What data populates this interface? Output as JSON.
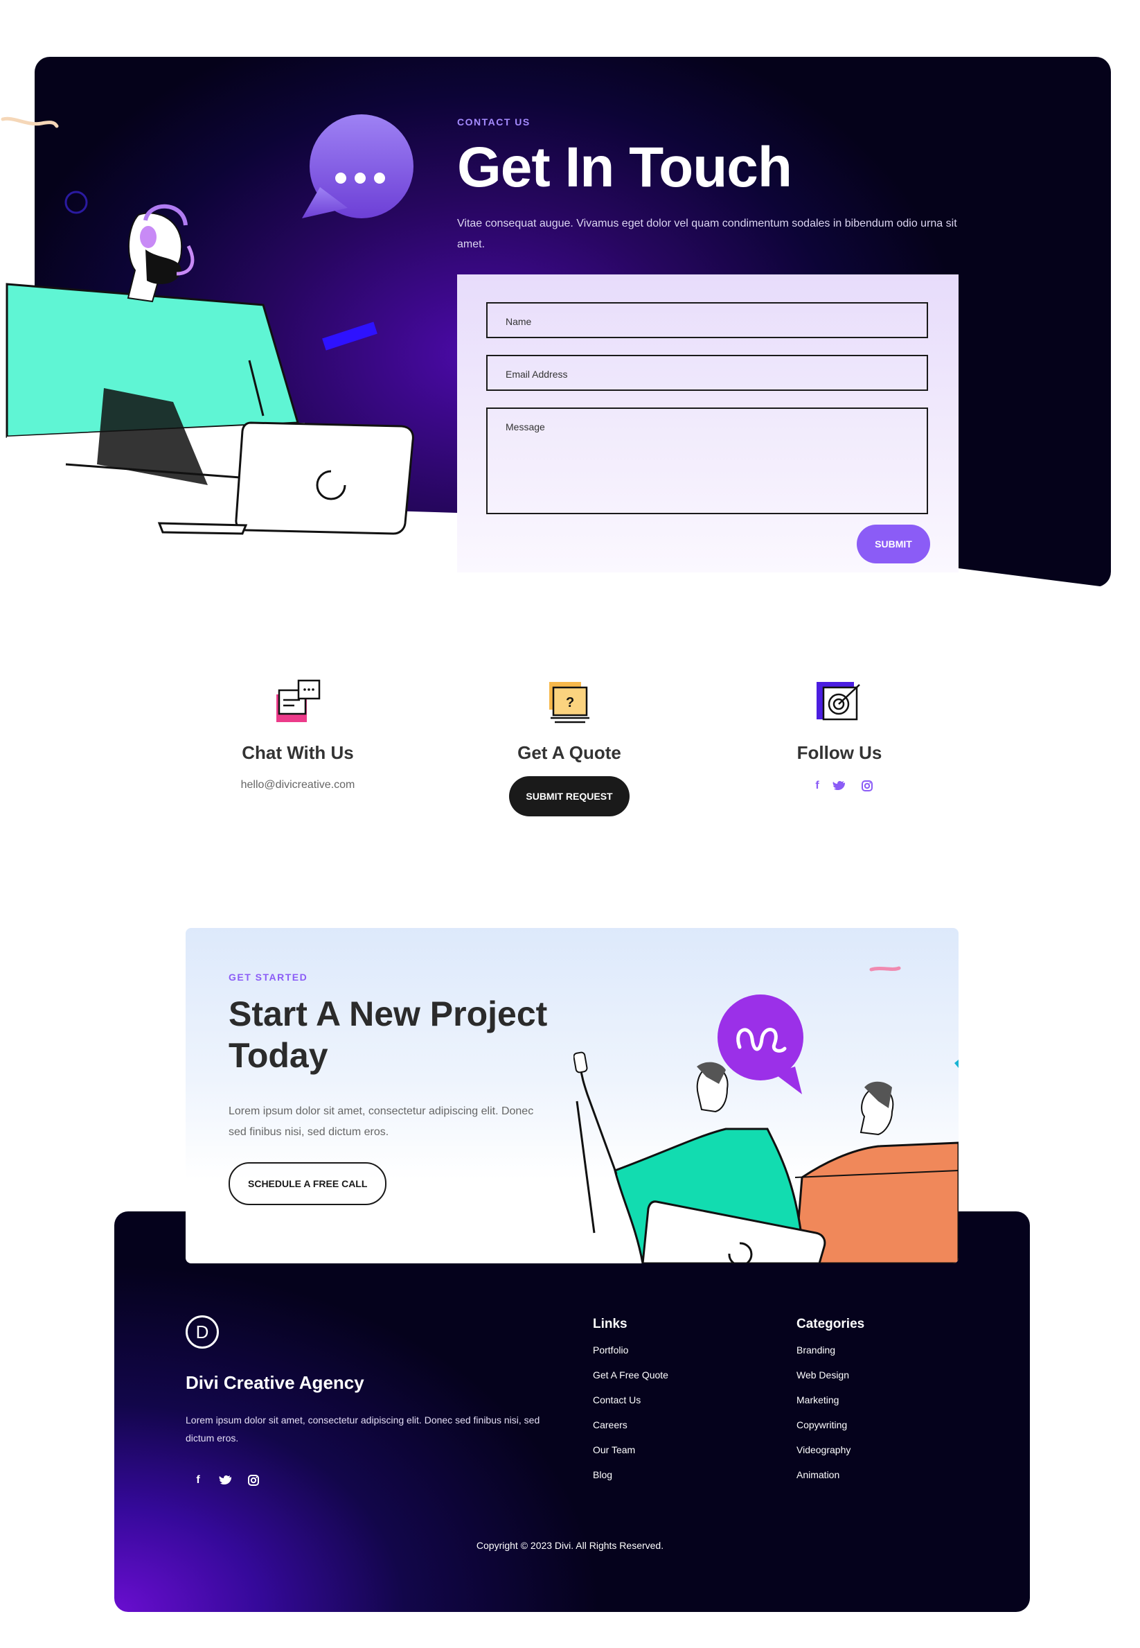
{
  "hero": {
    "eyebrow": "CONTACT US",
    "title": "Get In Touch",
    "description": "Vitae consequat augue. Vivamus eget dolor vel quam condimentum sodales in bibendum odio urna sit amet.",
    "form": {
      "name_placeholder": "Name",
      "email_placeholder": "Email Address",
      "message_placeholder": "Message",
      "submit_label": "SUBMIT"
    }
  },
  "info": {
    "chat": {
      "title": "Chat With Us",
      "email": "hello@divicreative.com",
      "icon": "chat-icon"
    },
    "quote": {
      "title": "Get A Quote",
      "button": "SUBMIT REQUEST",
      "icon": "quote-icon"
    },
    "follow": {
      "title": "Follow Us",
      "icons": [
        "facebook-icon",
        "twitter-icon",
        "instagram-icon"
      ]
    }
  },
  "cta": {
    "eyebrow": "GET STARTED",
    "title": "Start A New Project Today",
    "description": "Lorem ipsum dolor sit amet, consectetur adipiscing elit. Donec sed finibus nisi, sed dictum eros.",
    "button": "SCHEDULE A FREE CALL"
  },
  "footer": {
    "logo_letter": "D",
    "brand": "Divi Creative Agency",
    "description": "Lorem ipsum dolor sit amet, consectetur adipiscing elit. Donec sed finibus nisi, sed dictum eros.",
    "links": {
      "heading": "Links",
      "items": [
        "Portfolio",
        "Get A Free Quote",
        "Contact Us",
        "Careers",
        "Our Team",
        "Blog"
      ]
    },
    "categories": {
      "heading": "Categories",
      "items": [
        "Branding",
        "Web Design",
        "Marketing",
        "Copywriting",
        "Videography",
        "Animation"
      ]
    },
    "copyright": "Copyright © 2023 Divi. All Rights Reserved."
  },
  "colors": {
    "accent": "#8b5cf6",
    "dark_navy": "#0c0436",
    "teal": "#5ff5d4",
    "orange": "#f0885a"
  }
}
